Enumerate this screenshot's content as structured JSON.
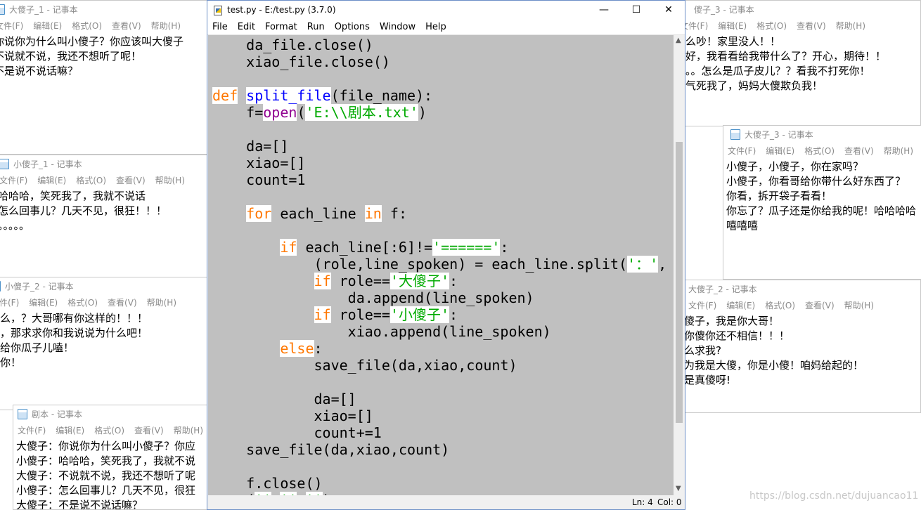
{
  "notepad_menu": [
    "文件(F)",
    "编辑(E)",
    "格式(O)",
    "查看(V)",
    "帮助(H)"
  ],
  "windows": {
    "dashazi1": {
      "title": "大傻子_1 - 记事本",
      "lines": [
        "你说你为什么叫小傻子？你应该叫大傻子",
        "不说就不说，我还不想听了呢！",
        "不是说不说话嘛？"
      ]
    },
    "xiaoshazi1": {
      "title": "小傻子_1 - 记事本",
      "lines": [
        "哈哈哈，笑死我了，我就不说话",
        "怎么回事儿？几天不见，很狂！！！",
        "。。。。。"
      ]
    },
    "xiaoshazi2": {
      "title": "小傻子_2 - 记事本",
      "lines": [
        "什么，？大哥哪有你这样的！！！",
        "个，那求求你和我说说为什么吧！",
        "，给你瓜子儿嗑！",
        "吧你！"
      ]
    },
    "juben": {
      "title": "剧本 - 记事本",
      "lines": [
        "大傻子：你说你为什么叫小傻子？你应",
        "小傻子：哈哈哈，笑死我了，我就不说",
        "大傻子：不说就不说，我还不想听了呢",
        "小傻子：怎么回事儿？几天不见，很狂",
        "大傻子：不是说不说话嘛？"
      ]
    },
    "xiaoshazi3": {
      "title": "傻子_3 - 记事本",
      "lines": [
        "么吵！家里没人！！",
        "好，我看看给我带什么了？开心，期待！！",
        "。。怎么是瓜子皮儿？？看我不打死你！",
        "气死我了，妈妈大傻欺负我！"
      ]
    },
    "dashazi3": {
      "title": "大傻子_3 - 记事本",
      "lines": [
        "小傻子，小傻子，你在家吗？",
        "小傻子，你看哥给你带什么好东西了？",
        "你看，拆开袋子看看！",
        "你忘了？瓜子还是你给我的呢！哈哈哈哈",
        "嘻嘻嘻"
      ]
    },
    "dashazi2": {
      "title": "大傻子_2 - 记事本",
      "lines": [
        "傻子，我是你大哥！",
        "你傻你还不相信！！！",
        "么求我?",
        "为我是大傻，你是小傻！咱妈给起的！",
        "是真傻呀!"
      ]
    }
  },
  "idle": {
    "title": "test.py - E:/test.py (3.7.0)",
    "menu": [
      "File",
      "Edit",
      "Format",
      "Run",
      "Options",
      "Window",
      "Help"
    ],
    "status": {
      "ln": "Ln: 4",
      "col": "Col: 0"
    },
    "code": [
      "    da_file.close()",
      "    xiao_file.close()",
      "",
      "def split_file(file_name):",
      "    f=open('E:\\\\剧本.txt')",
      "",
      "    da=[]",
      "    xiao=[]",
      "    count=1",
      "",
      "    for each_line in f:",
      "",
      "        if each_line[:6]!='======':",
      "            (role,line_spoken) = each_line.split('：',",
      "            if role=='大傻子':",
      "                da.append(line_spoken)",
      "            if role=='小傻子':",
      "                xiao.append(line_spoken)",
      "        else:",
      "            save_file(da,xiao,count)",
      "",
      "            da=[]",
      "            xiao=[]",
      "            count+=1",
      "    save_file(da,xiao,count)",
      "",
      "    f.close()",
      "    ('' '' '')"
    ]
  },
  "watermark": "https://blog.csdn.net/dujuancao11",
  "colors": {
    "keyword": "#ff7700",
    "builtin": "#900090",
    "string": "#00aa00",
    "definition": "#0000ff",
    "editor_bg": "#c0c0c0"
  }
}
